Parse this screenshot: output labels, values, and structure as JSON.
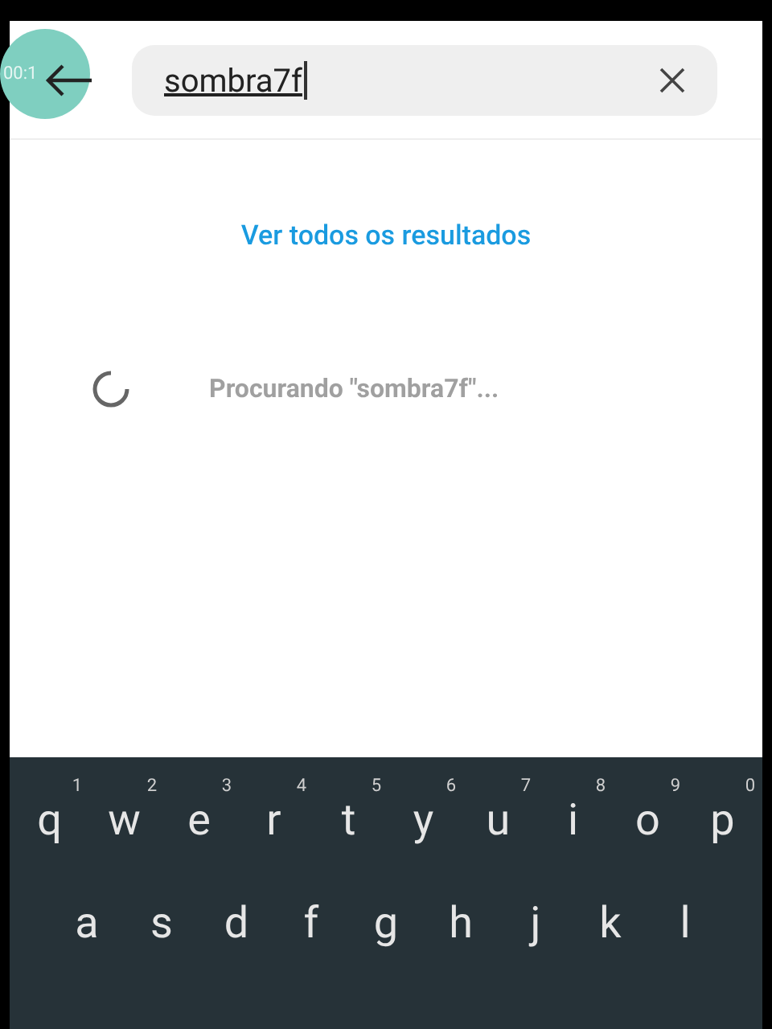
{
  "recording_badge": {
    "time": "00:1"
  },
  "search": {
    "value": "sombra7f"
  },
  "see_all_link": "Ver todos os resultados",
  "loading": {
    "text": "Procurando \"sombra7f\"..."
  },
  "keyboard": {
    "rows": [
      [
        {
          "label": "q",
          "hint": "1"
        },
        {
          "label": "w",
          "hint": "2"
        },
        {
          "label": "e",
          "hint": "3"
        },
        {
          "label": "r",
          "hint": "4"
        },
        {
          "label": "t",
          "hint": "5"
        },
        {
          "label": "y",
          "hint": "6"
        },
        {
          "label": "u",
          "hint": "7"
        },
        {
          "label": "i",
          "hint": "8"
        },
        {
          "label": "o",
          "hint": "9"
        },
        {
          "label": "p",
          "hint": "0"
        }
      ],
      [
        {
          "label": "a"
        },
        {
          "label": "s"
        },
        {
          "label": "d"
        },
        {
          "label": "f"
        },
        {
          "label": "g"
        },
        {
          "label": "h"
        },
        {
          "label": "j"
        },
        {
          "label": "k"
        },
        {
          "label": "l"
        }
      ]
    ]
  }
}
